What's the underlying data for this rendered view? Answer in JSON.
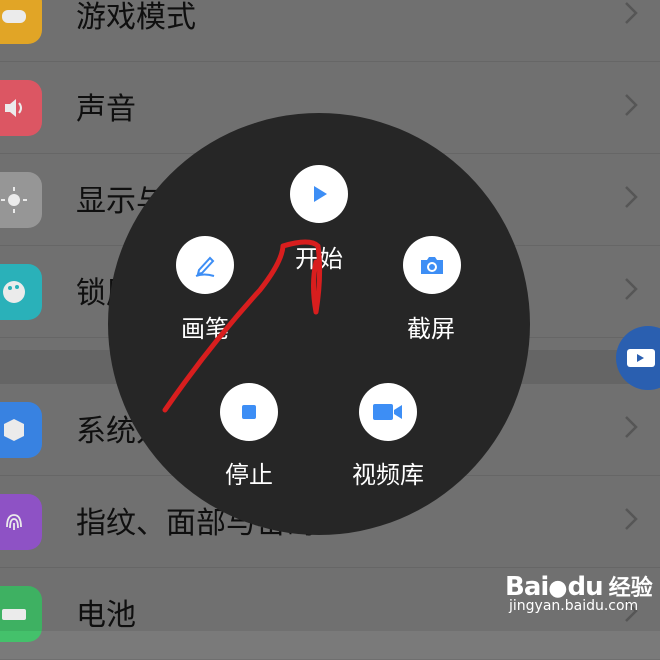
{
  "settings": {
    "items": [
      {
        "label": "游戏模式",
        "icon": "game-controller-icon",
        "color": "#f5b32a"
      },
      {
        "label": "声音",
        "icon": "speaker-icon",
        "color": "#ef5e6c"
      },
      {
        "label": "显示与亮度",
        "icon": "sun-icon",
        "color": "#a3a3a3"
      },
      {
        "label": "锁屏、桌面与壁纸",
        "icon": "palette-icon",
        "color": "#2ec1c9"
      },
      {
        "label": "系统升级",
        "icon": "cube-icon",
        "color": "#3d8ef5"
      },
      {
        "label": "指纹、面部与密码",
        "icon": "fingerprint-icon",
        "color": "#9b59d6"
      },
      {
        "label": "电池",
        "icon": "battery-icon",
        "color": "#44c16b"
      }
    ]
  },
  "wheel": {
    "start_label": "开始",
    "pen_label": "画笔",
    "screenshot_label": "截屏",
    "stop_label": "停止",
    "library_label": "视频库",
    "accent": "#3d8ef5"
  },
  "watermark": {
    "brand": "Bai",
    "brand_paw": "du",
    "product": "经验",
    "url": "jingyan.baidu.com"
  }
}
